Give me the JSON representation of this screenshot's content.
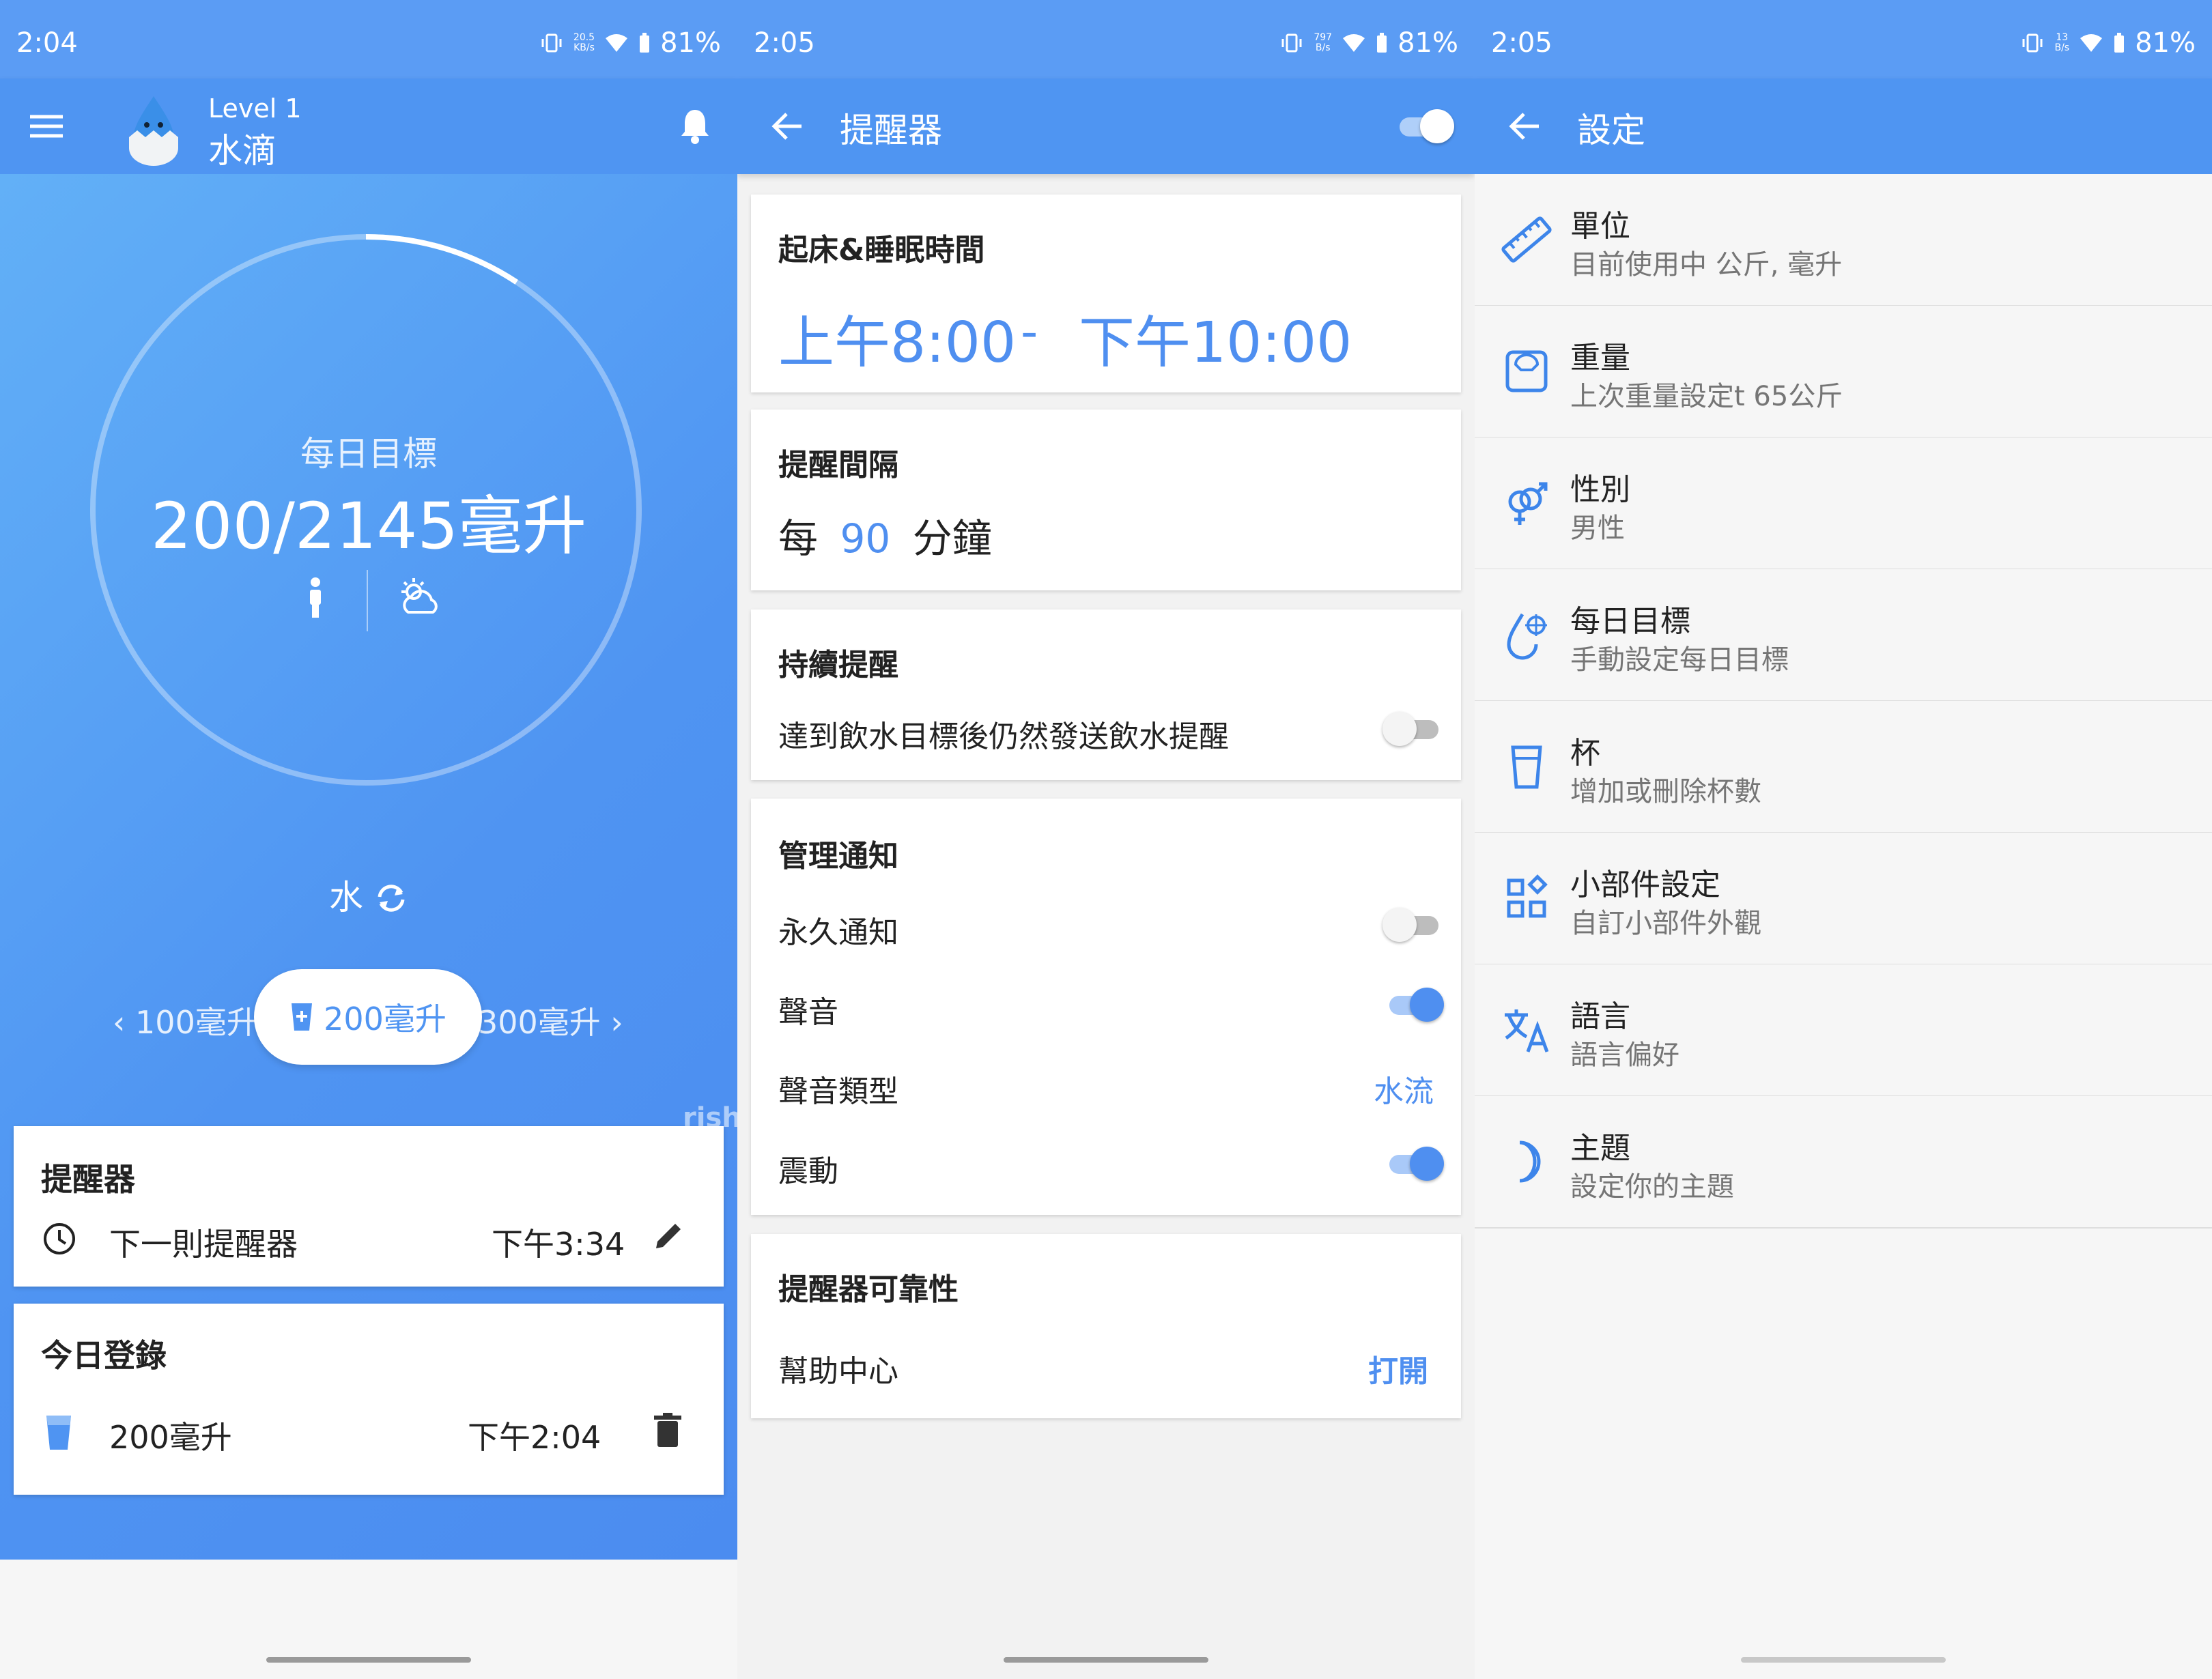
{
  "colors": {
    "primary": "#4f94f2",
    "accent": "#4f8ff0",
    "statusbar": "#5b9cf4"
  },
  "screen1": {
    "status": {
      "time": "2:04",
      "net_speed": "20.5",
      "net_unit": "KB/s",
      "battery": "81%"
    },
    "appbar": {
      "level": "Level 1",
      "name": "水滴",
      "menu_icon": "menu-icon",
      "bell_icon": "bell-icon"
    },
    "goal": {
      "label": "每日目標",
      "value": "200/2145毫升",
      "progress": 0.093
    },
    "drink_type": "水",
    "cups": {
      "prev": "100毫升",
      "current": "200毫升",
      "next": "300毫升"
    },
    "reminder_card": {
      "title": "提醒器",
      "row_label": "下一則提醒器",
      "time": "下午3:34"
    },
    "log_card": {
      "title": "今日登錄",
      "amount": "200毫升",
      "time": "下午2:04"
    },
    "watermark": "rjsh"
  },
  "screen2": {
    "status": {
      "time": "2:05",
      "net_speed": "797",
      "net_unit": "B/s",
      "battery": "81%"
    },
    "appbar": {
      "title": "提醒器",
      "enabled": true
    },
    "wake_sleep": {
      "title": "起床&睡眠時間",
      "start": "上午8:00",
      "separator": "-",
      "end": "下午10:00"
    },
    "interval": {
      "title": "提醒間隔",
      "prefix": "每",
      "value": "90",
      "suffix": "分鐘"
    },
    "continuous": {
      "title": "持續提醒",
      "label": "達到飲水目標後仍然發送飲水提醒",
      "enabled": false
    },
    "notifications": {
      "title": "管理通知",
      "persistent": {
        "label": "永久通知",
        "enabled": false
      },
      "sound": {
        "label": "聲音",
        "enabled": true
      },
      "sound_type": {
        "label": "聲音類型",
        "value": "水流"
      },
      "vibrate": {
        "label": "震動",
        "enabled": true
      }
    },
    "reliability": {
      "title": "提醒器可靠性",
      "label": "幫助中心",
      "action": "打開"
    }
  },
  "screen3": {
    "status": {
      "time": "2:05",
      "net_speed": "13",
      "net_unit": "B/s",
      "battery": "81%"
    },
    "appbar": {
      "title": "設定"
    },
    "items": [
      {
        "title": "單位",
        "subtitle": "目前使用中 公斤, 毫升",
        "icon": "ruler-icon"
      },
      {
        "title": "重量",
        "subtitle": "上次重量設定t 65公斤",
        "icon": "scale-icon"
      },
      {
        "title": "性別",
        "subtitle": "男性",
        "icon": "gender-icon"
      },
      {
        "title": "每日目標",
        "subtitle": "手動設定每日目標",
        "icon": "target-drop-icon"
      },
      {
        "title": "杯",
        "subtitle": "增加或刪除杯數",
        "icon": "cup-icon"
      },
      {
        "title": "小部件設定",
        "subtitle": "自訂小部件外觀",
        "icon": "widgets-icon"
      },
      {
        "title": "語言",
        "subtitle": "語言偏好",
        "icon": "translate-icon"
      },
      {
        "title": "主題",
        "subtitle": "設定你的主題",
        "icon": "moon-icon"
      }
    ]
  }
}
